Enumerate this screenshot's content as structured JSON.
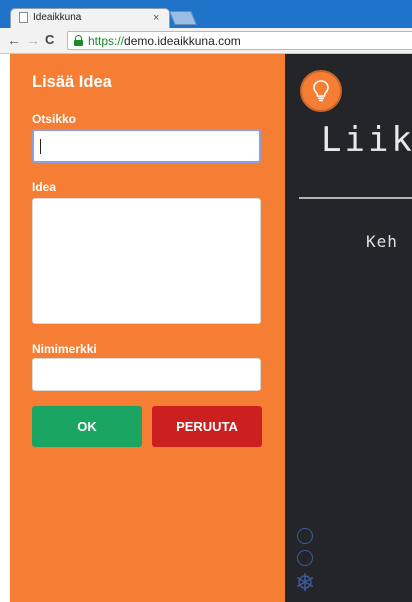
{
  "browser": {
    "tab_title": "Ideaikkuna",
    "tab_close": "×",
    "url_scheme": "https://",
    "url_host": "demo.ideaikkuna.com",
    "back_glyph": "←",
    "forward_glyph": "→",
    "reload_glyph": "C"
  },
  "form": {
    "heading": "Lisää Idea",
    "title_label": "Otsikko",
    "title_value": "",
    "idea_label": "Idea",
    "idea_value": "",
    "nick_label": "Nimimerkki",
    "nick_value": "",
    "ok_label": "OK",
    "cancel_label": "PERUUTA"
  },
  "board": {
    "title_fragment": "Liik",
    "subtitle_fragment": "Keh",
    "bulb_icon": "lightbulb-icon"
  },
  "colors": {
    "panel": "#f57e34",
    "ok": "#1ba562",
    "cancel": "#cc1f1f",
    "board": "#232528",
    "tabstrip": "#1f73c9"
  }
}
